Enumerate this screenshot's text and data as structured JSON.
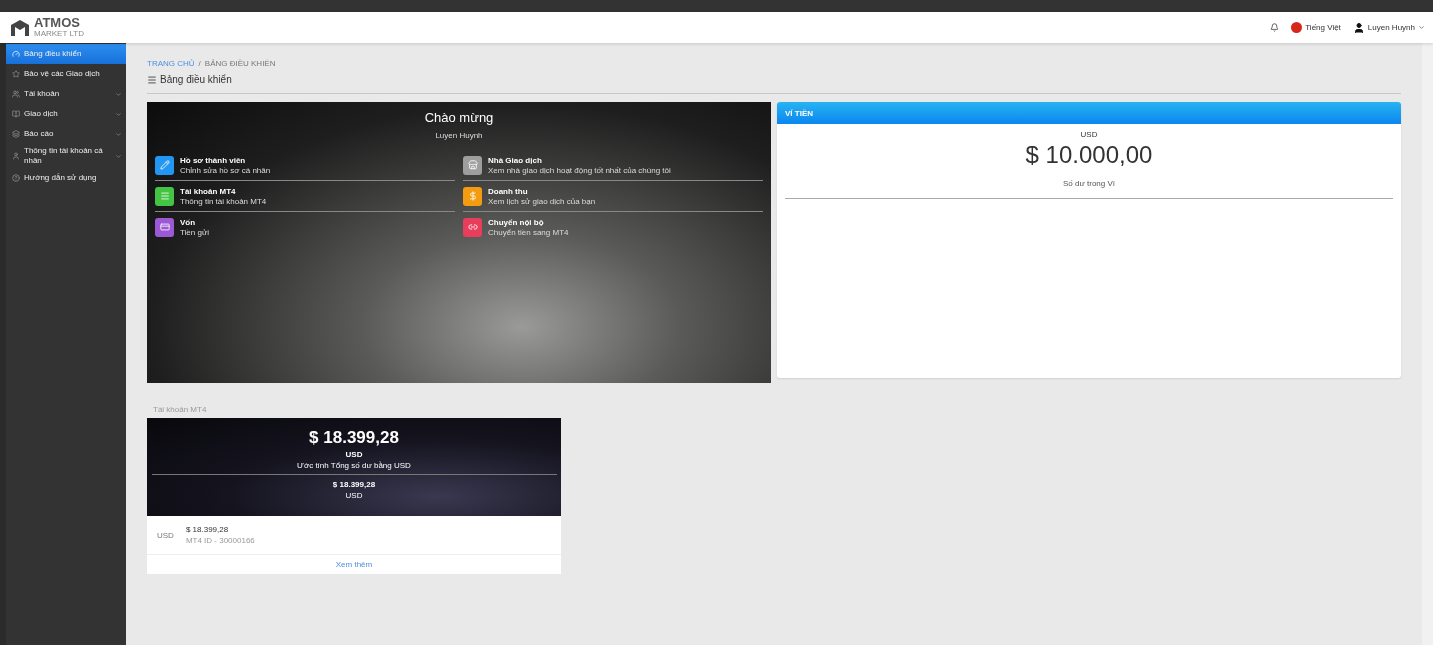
{
  "brand": {
    "name": "ATMOS",
    "tagline": "MARKET LTD"
  },
  "header": {
    "language": "Tiếng Việt",
    "user": "Luyen Huynh"
  },
  "sidebar": {
    "items": [
      {
        "label": "Bảng điều khiển",
        "selected": true,
        "expandable": false
      },
      {
        "label": "Bảo vệ các Giao dịch",
        "selected": false,
        "expandable": false
      },
      {
        "label": "Tài khoản",
        "selected": false,
        "expandable": true
      },
      {
        "label": "Giao dịch",
        "selected": false,
        "expandable": true
      },
      {
        "label": "Báo cáo",
        "selected": false,
        "expandable": true
      },
      {
        "label": "Thông tin tài khoản cá nhân",
        "selected": false,
        "expandable": true
      },
      {
        "label": "Hướng dẫn sử dụng",
        "selected": false,
        "expandable": false
      }
    ]
  },
  "breadcrumb": [
    "TRANG CHỦ",
    "BẢNG ĐIỀU KHIỂN"
  ],
  "breadcrumb_separator": "/",
  "page_title": "Bảng điều khiển",
  "welcome": {
    "title": "Chào mừng",
    "name": "Luyen Huynh",
    "tiles": [
      {
        "title": "Hồ sơ thành viên",
        "subtitle": "Chỉnh sửa hồ sơ cá nhân",
        "color": "#2196f3"
      },
      {
        "title": "Nhà Giao dịch",
        "subtitle": "Xem nhà giao dịch hoạt động tốt nhất của chúng tôi",
        "color": "#9e9e9e"
      },
      {
        "title": "Tài khoản MT4",
        "subtitle": "Thông tin tài khoản MT4",
        "color": "#43c443"
      },
      {
        "title": "Doanh thu",
        "subtitle": "Xem lịch sử giao dịch của bạn",
        "color": "#f39c12"
      },
      {
        "title": "Vốn",
        "subtitle": "Tiền gửi",
        "color": "#9b59d6"
      },
      {
        "title": "Chuyển nội bộ",
        "subtitle": "Chuyển tiền sang MT4",
        "color": "#e83e5c"
      }
    ]
  },
  "wallet": {
    "title": "VÍ TIỀN",
    "currency": "USD",
    "amount": "$ 10.000,00",
    "caption": "Số dư trong Ví"
  },
  "mt4": {
    "section_label": "Tài khoản MT4",
    "total": "$ 18.399,28",
    "total_currency": "USD",
    "total_caption": "Ước tính Tổng số dư bằng USD",
    "sub_total": "$ 18.399,28",
    "sub_currency": "USD",
    "rows": [
      {
        "currency": "USD",
        "amount": "$ 18.399,28",
        "account": "MT4 ID - 30000166"
      }
    ],
    "more": "Xem thêm"
  }
}
